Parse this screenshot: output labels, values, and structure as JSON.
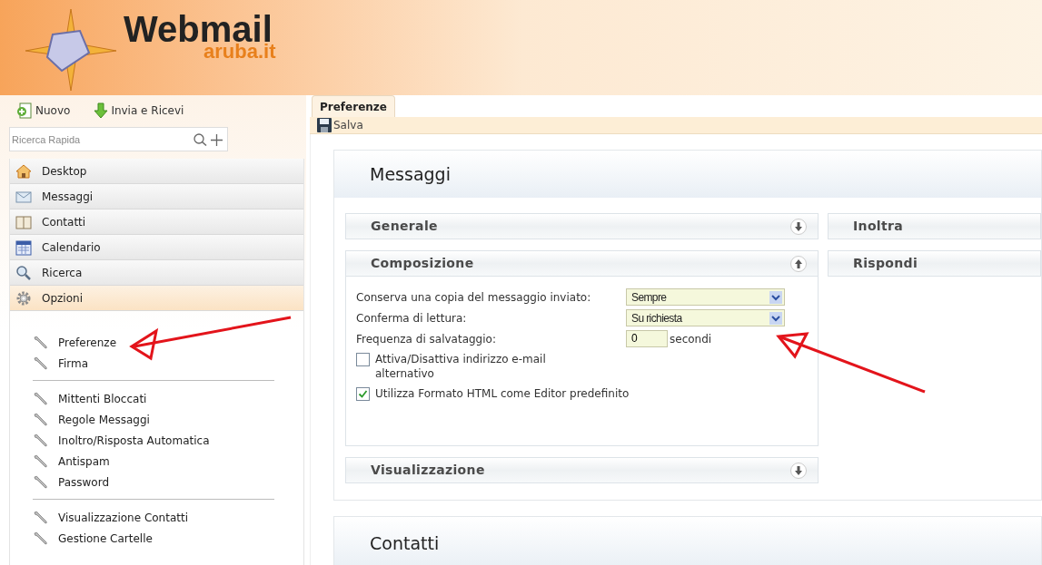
{
  "logo": {
    "title": "Webmail",
    "subtitle": "aruba.it"
  },
  "toolbar": [
    {
      "label": "Nuovo",
      "kind": "new"
    },
    {
      "label": "Invia e Ricevi",
      "kind": "receive"
    }
  ],
  "search": {
    "placeholder": "Ricerca Rapida"
  },
  "nav": [
    {
      "label": "Desktop",
      "kind": "home",
      "selected": false
    },
    {
      "label": "Messaggi",
      "kind": "mail",
      "selected": false
    },
    {
      "label": "Contatti",
      "kind": "book",
      "selected": false
    },
    {
      "label": "Calendario",
      "kind": "calendar",
      "selected": false
    },
    {
      "label": "Ricerca",
      "kind": "search",
      "selected": false
    },
    {
      "label": "Opzioni",
      "kind": "gear",
      "selected": true
    }
  ],
  "options_groups": [
    [
      "Preferenze",
      "Firma"
    ],
    [
      "Mittenti Bloccati",
      "Regole Messaggi",
      "Inoltro/Risposta Automatica",
      "Antispam",
      "Password"
    ],
    [
      "Visualizzazione Contatti",
      "Gestione Cartelle"
    ]
  ],
  "tab": {
    "label": "Preferenze",
    "selected": true
  },
  "save_button": "Salva",
  "panels": [
    {
      "title": "Messaggi",
      "sections": [
        {
          "title": "Generale",
          "expanded": false
        },
        {
          "title": "Composizione",
          "expanded": true,
          "rows": [
            {
              "kind": "select",
              "label": "Conserva una copia del messaggio inviato:",
              "value": "Sempre"
            },
            {
              "kind": "select",
              "label": "Conferma di lettura:",
              "value": "Su richiesta"
            },
            {
              "kind": "number",
              "label": "Frequenza di salvataggio:",
              "value": "0",
              "unit": "secondi"
            },
            {
              "kind": "checkbox",
              "label": "Attiva/Disattiva indirizzo e-mail alternativo",
              "checked": false
            },
            {
              "kind": "checkbox",
              "label": "Utilizza Formato HTML come Editor predefinito",
              "checked": true
            }
          ]
        },
        {
          "title": "Visualizzazione",
          "expanded": false
        }
      ],
      "side_sections": [
        {
          "title": "Inoltra"
        },
        {
          "title": "Rispondi"
        }
      ]
    },
    {
      "title": "Contatti"
    }
  ]
}
